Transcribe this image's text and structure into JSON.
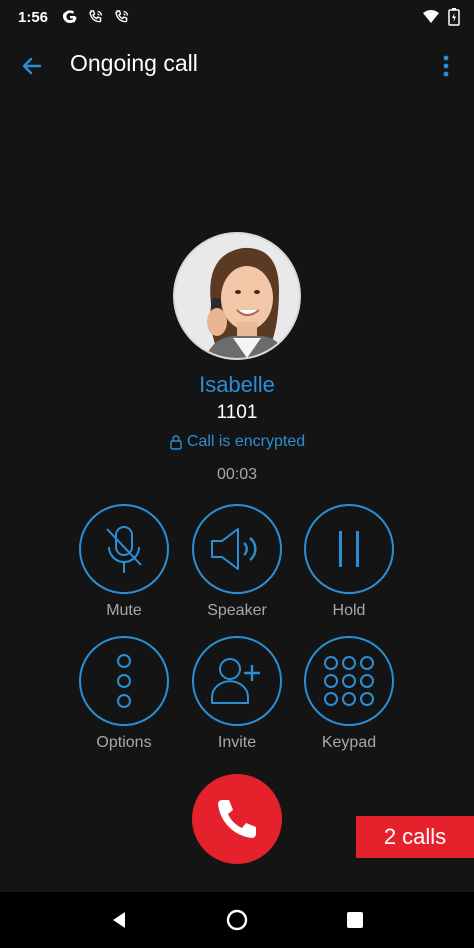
{
  "status_bar": {
    "time": "1:56",
    "icons": [
      "google-icon",
      "phone-call-icon",
      "phone-call-icon",
      "wifi-icon",
      "battery-icon"
    ]
  },
  "app_bar": {
    "title": "Ongoing call",
    "back_icon": "arrow-left-icon",
    "menu_icon": "more-vertical-icon"
  },
  "contact": {
    "name": "Isabelle",
    "number": "1101",
    "encryption_text": "Call is encrypted",
    "duration": "00:03"
  },
  "controls": {
    "mute": "Mute",
    "speaker": "Speaker",
    "hold": "Hold",
    "options": "Options",
    "invite": "Invite",
    "keypad": "Keypad"
  },
  "calls_badge": "2 calls",
  "colors": {
    "accent": "#2a8fd6",
    "end_call": "#e5222c",
    "background": "#141414"
  }
}
